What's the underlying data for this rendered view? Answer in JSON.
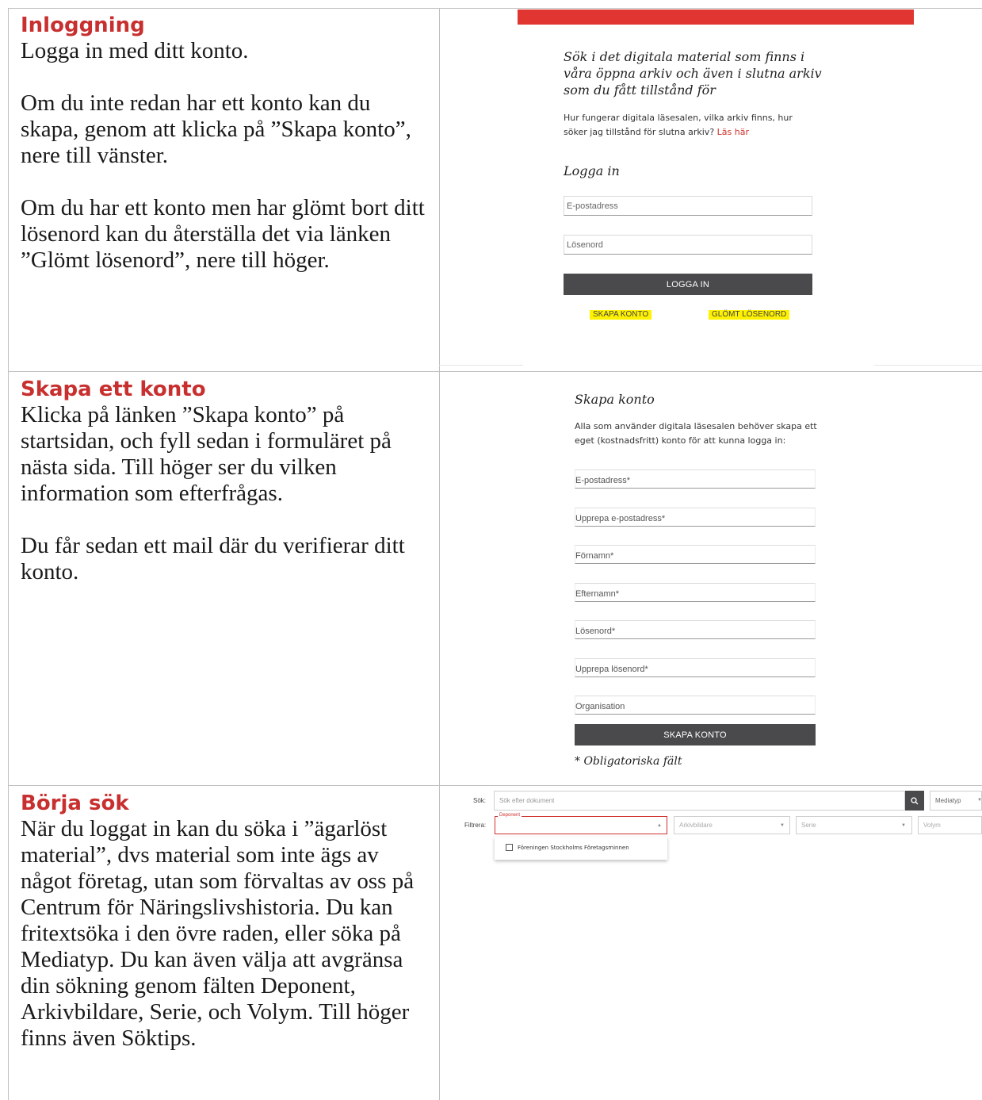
{
  "sections": [
    {
      "heading": "Inloggning",
      "paragraphs": [
        "Logga in med ditt konto.",
        "Om du inte redan har ett konto kan du skapa, genom att klicka på ”Skapa konto”, nere till vänster.",
        "Om du har ett konto men har glömt bort ditt lösenord kan du återställa det via länken ”Glömt lösenord”, nere till höger."
      ]
    },
    {
      "heading": "Skapa ett konto",
      "paragraphs": [
        "Klicka på länken ”Skapa konto” på startsidan, och fyll sedan i formuläret på nästa sida. Till höger ser du vilken information som efterfrågas.",
        "Du får sedan ett mail där du verifierar ditt konto."
      ]
    },
    {
      "heading": "Börja sök",
      "paragraphs": [
        "När du loggat in kan du söka i ”ägarlöst material”, dvs material som inte ägs av något företag, utan som förvaltas av oss på Centrum för Näringslivshistoria. Du kan fritextsöka i den övre raden, eller söka på Mediatyp. Du kan även välja att avgränsa din sökning genom fälten Deponent, Arkivbildare, Serie, och Volym. Till höger finns även Söktips."
      ]
    }
  ],
  "login": {
    "intro": "Sök i det digitala material som finns i våra öppna arkiv och även i slutna arkiv som du fått tillstånd för",
    "help_text": "Hur fungerar digitala läsesalen, vilka arkiv finns, hur söker jag tillstånd för slutna arkiv?",
    "help_link": "Läs här",
    "title": "Logga in",
    "email_placeholder": "E-postadress",
    "password_placeholder": "Lösenord",
    "submit": "LOGGA IN",
    "create_link": "SKAPA KONTO",
    "forgot_link": "GLÖMT LÖSENORD",
    "accent": "#e03531",
    "highlight": "#fff200"
  },
  "register": {
    "title": "Skapa konto",
    "text": "Alla som använder digitala läsesalen behöver skapa ett eget (kostnadsfritt) konto för att kunna logga in:",
    "fields": [
      "E-postadress*",
      "Upprepa e-postadress*",
      "Förnamn*",
      "Efternamn*",
      "Lösenord*",
      "Upprepa lösenord*",
      "Organisation"
    ],
    "submit": "SKAPA KONTO",
    "note": "* Obligatoriska fält"
  },
  "search": {
    "search_label": "Sök:",
    "search_placeholder": "Sök efter dokument",
    "mediatype": "Mediatyp",
    "filter_label": "Filtrera:",
    "deponent": "Deponent",
    "arkivbildare": "Arkivbildare",
    "serie": "Serie",
    "volym": "Volym",
    "option": "Föreningen Stockholms Företagsminnen"
  }
}
